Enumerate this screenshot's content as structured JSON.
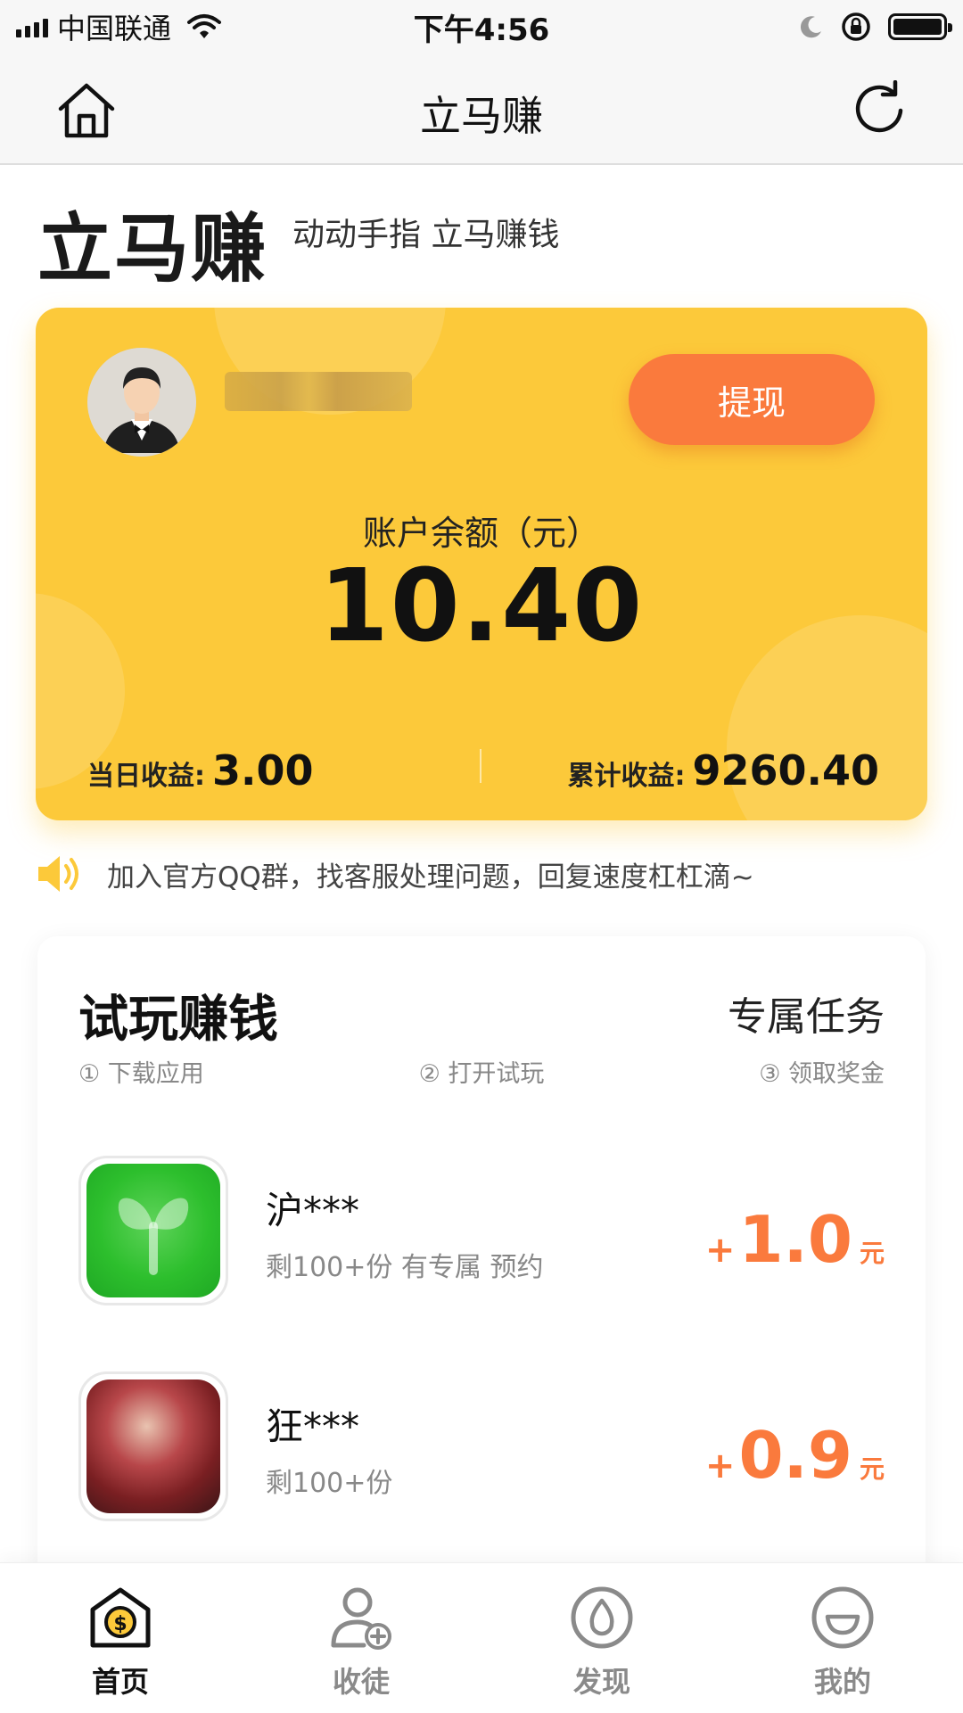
{
  "status_bar": {
    "carrier": "中国联通",
    "time": "下午4:56"
  },
  "nav": {
    "title": "立马赚"
  },
  "header": {
    "brand": "立马赚",
    "slogan": "动动手指 立马赚钱"
  },
  "account": {
    "withdraw_label": "提现",
    "balance_label": "账户余额（元）",
    "balance": "10.40",
    "today_label": "当日收益:",
    "today_value": "3.00",
    "total_label": "累计收益:",
    "total_value": "9260.40"
  },
  "notice": {
    "text": "加入官方QQ群，找客服处理问题，回复速度杠杠滴~"
  },
  "tasks": {
    "title": "试玩赚钱",
    "link": "专属任务",
    "steps": [
      "① 下载应用",
      "② 打开试玩",
      "③ 领取奖金"
    ],
    "apps": [
      {
        "name": "沪***",
        "desc": "剩100+份  有专属  预约",
        "plus": "+",
        "amount": "1.0",
        "unit": "元"
      },
      {
        "name": "狂***",
        "desc": "剩100+份",
        "plus": "+",
        "amount": "0.9",
        "unit": "元"
      }
    ]
  },
  "tabbar": {
    "items": [
      {
        "label": "首页"
      },
      {
        "label": "收徒"
      },
      {
        "label": "发现"
      },
      {
        "label": "我的"
      }
    ]
  },
  "colors": {
    "card": "#fcc93a",
    "accent": "#fa7a3d",
    "muted": "#888888"
  }
}
